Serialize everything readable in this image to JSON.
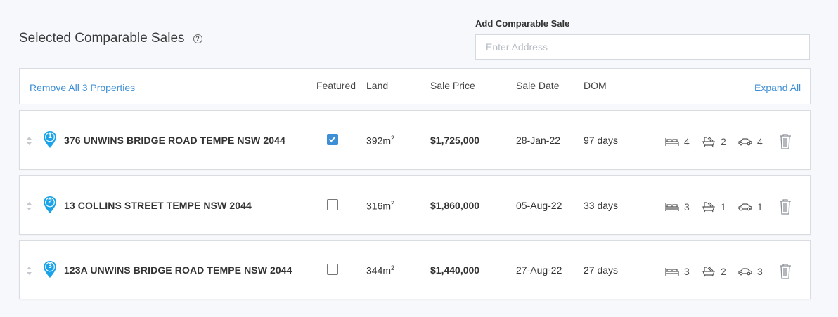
{
  "section": {
    "title": "Selected Comparable Sales",
    "help_icon": "question-circle-icon"
  },
  "add_sale": {
    "label": "Add Comparable Sale",
    "placeholder": "Enter Address",
    "value": ""
  },
  "table": {
    "remove_all_label": "Remove All 3 Properties",
    "expand_all_label": "Expand All",
    "columns": {
      "featured": "Featured",
      "land": "Land",
      "sale_price": "Sale Price",
      "sale_date": "Sale Date",
      "dom": "DOM"
    }
  },
  "properties": [
    {
      "number": "1",
      "address": "376 UNWINS BRIDGE ROAD TEMPE NSW 2044",
      "featured": true,
      "land_value": "392m",
      "land_unit": "2",
      "sale_price": "$1,725,000",
      "sale_date": "28-Jan-22",
      "dom": "97 days",
      "beds": "4",
      "baths": "2",
      "cars": "4"
    },
    {
      "number": "2",
      "address": "13 COLLINS STREET TEMPE NSW 2044",
      "featured": false,
      "land_value": "316m",
      "land_unit": "2",
      "sale_price": "$1,860,000",
      "sale_date": "05-Aug-22",
      "dom": "33 days",
      "beds": "3",
      "baths": "1",
      "cars": "1"
    },
    {
      "number": "3",
      "address": "123A UNWINS BRIDGE ROAD TEMPE NSW 2044",
      "featured": false,
      "land_value": "344m",
      "land_unit": "2",
      "sale_price": "$1,440,000",
      "sale_date": "27-Aug-22",
      "dom": "27 days",
      "beds": "3",
      "baths": "2",
      "cars": "3"
    }
  ],
  "colors": {
    "accent": "#3d8fd6",
    "pin": "#1aa3e8",
    "border": "#d9dde2",
    "background": "#f6f8fb"
  },
  "icons": {
    "bed": "bed-icon",
    "bath": "bath-icon",
    "car": "car-icon",
    "delete": "trash-icon",
    "drag": "sort-handle-icon",
    "marker": "map-pin-icon"
  }
}
